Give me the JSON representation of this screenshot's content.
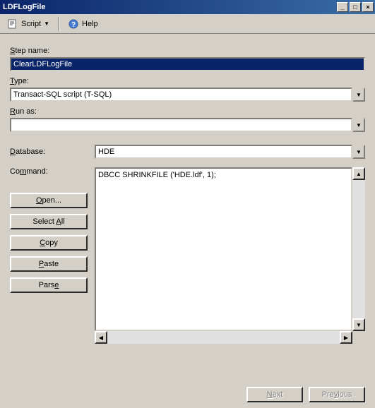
{
  "window": {
    "title": "LDFLogFile"
  },
  "titleButtons": {
    "minimize": "_",
    "maximize": "□",
    "close": "×"
  },
  "toolbar": {
    "script_label": "Script",
    "help_label": "Help"
  },
  "labels": {
    "step_name": "Step name:",
    "type": "Type:",
    "run_as": "Run as:",
    "database": "Database:",
    "command": "Command:"
  },
  "fields": {
    "step_name_value": "ClearLDFLogFile",
    "type_value": "Transact-SQL script (T-SQL)",
    "run_as_value": "",
    "database_value": "HDE",
    "command_value": "DBCC SHRINKFILE ('HDE.ldf', 1);"
  },
  "buttons": {
    "open": "Open...",
    "select_all": "Select All",
    "copy": "Copy",
    "paste": "Paste",
    "parse": "Parse",
    "next": "Next",
    "previous": "Previous"
  }
}
